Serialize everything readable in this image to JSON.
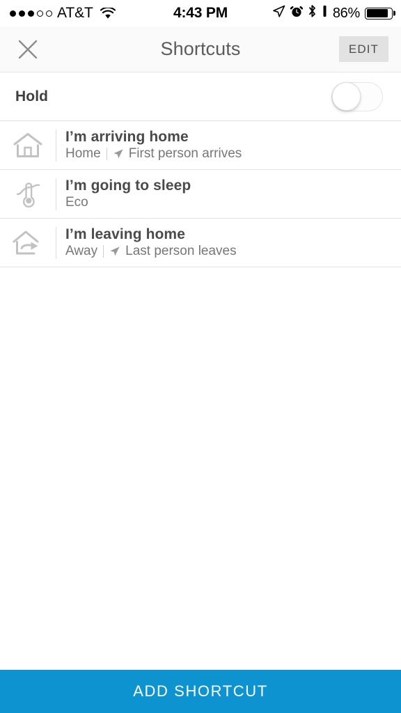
{
  "status_bar": {
    "signal_dots_filled": 3,
    "signal_dots_total": 5,
    "carrier": "AT&T",
    "wifi_icon": "wifi-icon",
    "time": "4:43 PM",
    "location_icon": "location-arrow-icon",
    "alarm_icon": "alarm-clock-icon",
    "bluetooth_icon": "bluetooth-icon",
    "rotation_lock_icon": "portrait-lock-icon",
    "battery_percent": "86%",
    "battery_level": 86
  },
  "navbar": {
    "close_icon": "close-x-icon",
    "title": "Shortcuts",
    "edit_label": "EDIT"
  },
  "hold": {
    "label": "Hold",
    "toggle_state": "off",
    "toggle_name": "hold-toggle"
  },
  "shortcuts": [
    {
      "icon": "house-icon",
      "title": "I’m arriving home",
      "mode": "Home",
      "trigger_icon": "navigation-arrow-icon",
      "trigger": "First person arrives"
    },
    {
      "icon": "thermometer-eco-icon",
      "title": "I’m going to sleep",
      "mode": "Eco",
      "trigger_icon": "",
      "trigger": ""
    },
    {
      "icon": "house-leaving-icon",
      "title": "I’m leaving home",
      "mode": "Away",
      "trigger_icon": "navigation-arrow-icon",
      "trigger": "Last person leaves"
    }
  ],
  "footer": {
    "add_label": "ADD SHORTCUT",
    "accent_color": "#0d93cf"
  }
}
